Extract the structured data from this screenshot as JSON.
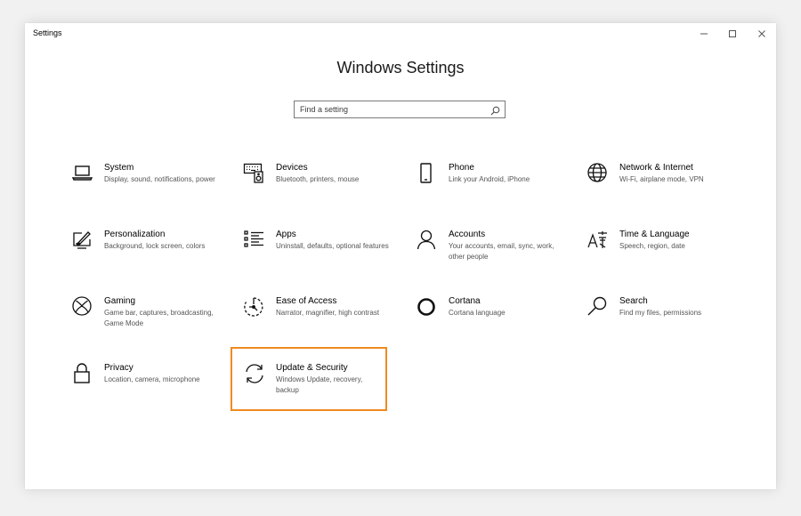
{
  "window": {
    "app_title": "Settings",
    "controls": {
      "minimize_icon": "minimize-icon",
      "maximize_icon": "maximize-icon",
      "close_icon": "close-icon"
    }
  },
  "page_title": "Windows Settings",
  "search": {
    "placeholder": "Find a setting",
    "value": "",
    "icon": "search-icon"
  },
  "accent_colors": {
    "highlight": "#f08a20",
    "description": "#555555"
  },
  "tiles": [
    {
      "title": "System",
      "description": "Display, sound, notifications, power",
      "icon": "laptop-icon"
    },
    {
      "title": "Devices",
      "description": "Bluetooth, printers, mouse",
      "icon": "keyboard-speaker-icon"
    },
    {
      "title": "Phone",
      "description": "Link your Android, iPhone",
      "icon": "phone-icon"
    },
    {
      "title": "Network & Internet",
      "description": "Wi-Fi, airplane mode, VPN",
      "icon": "globe-icon"
    },
    {
      "title": "Personalization",
      "description": "Background, lock screen, colors",
      "icon": "paint-monitor-icon"
    },
    {
      "title": "Apps",
      "description": "Uninstall, defaults, optional features",
      "icon": "list-icon"
    },
    {
      "title": "Accounts",
      "description": "Your accounts, email, sync, work, other people",
      "icon": "person-icon"
    },
    {
      "title": "Time & Language",
      "description": "Speech, region, date",
      "icon": "time-language-icon"
    },
    {
      "title": "Gaming",
      "description": "Game bar, captures, broadcasting, Game Mode",
      "icon": "xbox-icon"
    },
    {
      "title": "Ease of Access",
      "description": "Narrator, magnifier, high contrast",
      "icon": "ease-of-access-icon"
    },
    {
      "title": "Cortana",
      "description": "Cortana language",
      "icon": "cortana-icon"
    },
    {
      "title": "Search",
      "description": "Find my files, permissions",
      "icon": "magnifier-icon"
    },
    {
      "title": "Privacy",
      "description": "Location, camera, microphone",
      "icon": "lock-icon"
    },
    {
      "title": "Update & Security",
      "description": "Windows Update, recovery, backup",
      "icon": "sync-arrows-icon",
      "highlighted": true
    }
  ]
}
